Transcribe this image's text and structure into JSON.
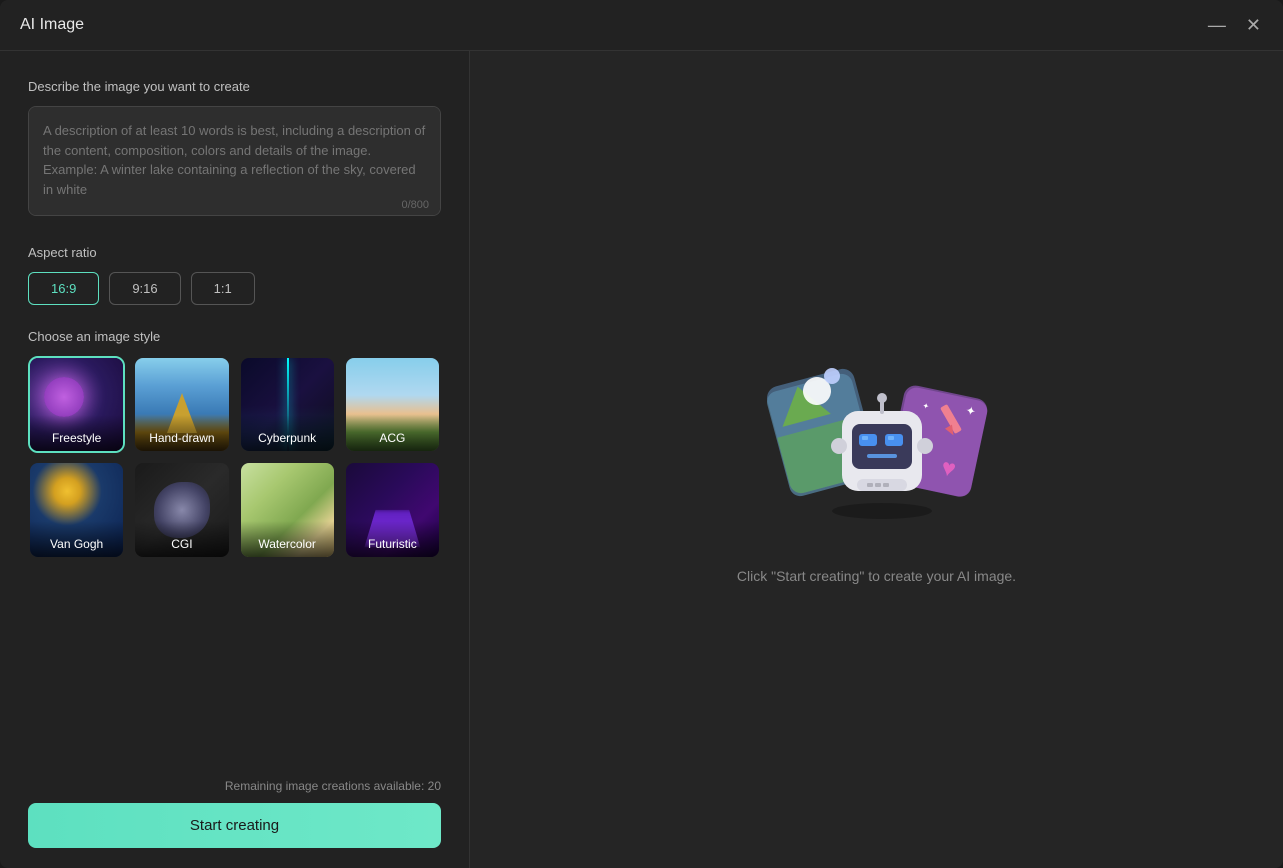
{
  "window": {
    "title": "AI Image"
  },
  "controls": {
    "minimize": "—",
    "close": "✕"
  },
  "left": {
    "describe_label": "Describe the image you want to create",
    "textarea_placeholder": "A description of at least 10 words is best, including a description of the content, composition, colors and details of the image. Example: A winter lake containing a reflection of the sky, covered in white",
    "char_count": "0/800",
    "aspect_label": "Aspect ratio",
    "aspect_options": [
      {
        "id": "16:9",
        "label": "16:9",
        "active": true
      },
      {
        "id": "9:16",
        "label": "9:16",
        "active": false
      },
      {
        "id": "1:1",
        "label": "1:1",
        "active": false
      }
    ],
    "style_label": "Choose an image style",
    "styles": [
      {
        "id": "freestyle",
        "label": "Freestyle",
        "selected": true
      },
      {
        "id": "hand-drawn",
        "label": "Hand-drawn",
        "selected": false
      },
      {
        "id": "cyberpunk",
        "label": "Cyberpunk",
        "selected": false
      },
      {
        "id": "acg",
        "label": "ACG",
        "selected": false
      },
      {
        "id": "van-gogh",
        "label": "Van Gogh",
        "selected": false
      },
      {
        "id": "cgi",
        "label": "CGI",
        "selected": false
      },
      {
        "id": "watercolor",
        "label": "Watercolor",
        "selected": false
      },
      {
        "id": "futuristic",
        "label": "Futuristic",
        "selected": false
      }
    ],
    "remaining_text": "Remaining image creations available: 20",
    "start_button": "Start creating"
  },
  "right": {
    "placeholder_text": "Click \"Start creating\" to create your AI image."
  }
}
